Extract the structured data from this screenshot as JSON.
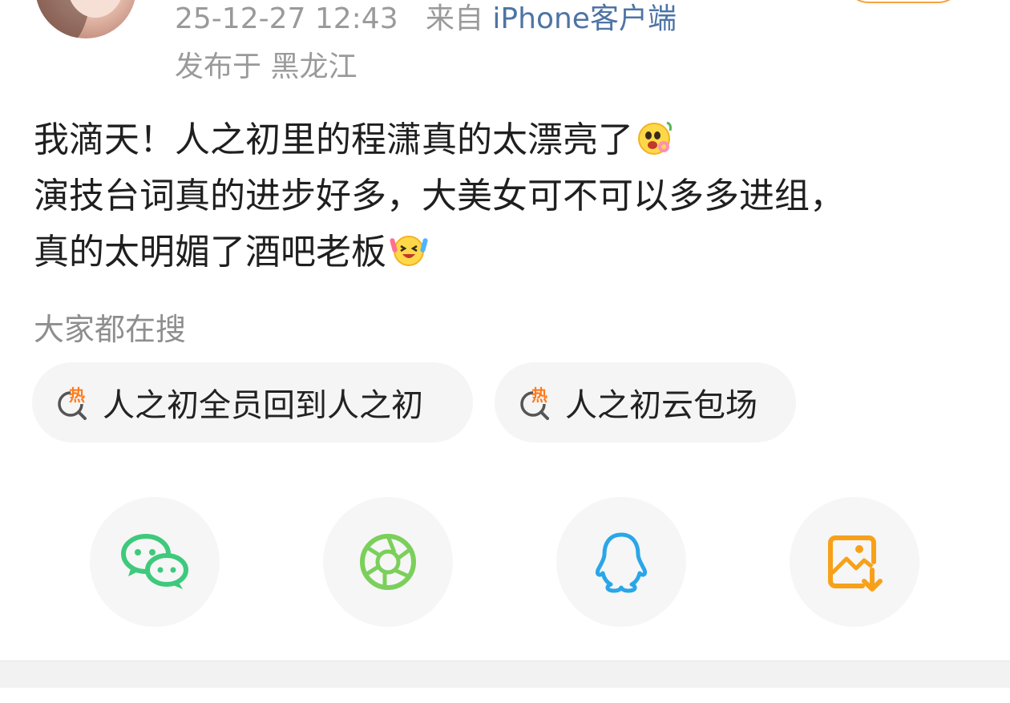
{
  "post": {
    "timestamp": "25-12-27 12:43",
    "source_prefix": "来自",
    "source": "iPhone客户端",
    "location": "发布于 黑龙江",
    "content_lines": [
      "我滴天！人之初里的程潇真的太漂亮了",
      "演技台词真的进步好多，大美女可不可以多多进组，",
      "真的太明媚了酒吧老板"
    ],
    "emojis": [
      "flower-face-emoji",
      "excited-face-emoji"
    ]
  },
  "hot_search": {
    "title": "大家都在搜",
    "items": [
      {
        "label": "人之初全员回到人之初",
        "icon": "hot-search-icon",
        "badge": "热"
      },
      {
        "label": "人之初云包场",
        "icon": "hot-search-icon",
        "badge": "热"
      }
    ]
  },
  "share": {
    "items": [
      {
        "name": "wechat",
        "icon": "wechat-icon",
        "color": "#3ec97c"
      },
      {
        "name": "moments",
        "icon": "moments-icon",
        "color": "#7bcf5b"
      },
      {
        "name": "qq",
        "icon": "qq-icon",
        "color": "#2aa6e8"
      },
      {
        "name": "save-image",
        "icon": "save-image-icon",
        "color": "#f7a11a"
      }
    ]
  },
  "colors": {
    "meta_gray": "#9a9a9a",
    "source_blue": "#4d74a5",
    "accent_orange": "#f7a13d",
    "chip_bg": "#f5f5f5"
  }
}
